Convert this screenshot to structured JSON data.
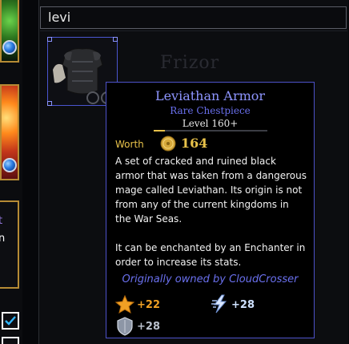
{
  "search": {
    "query": "levi"
  },
  "background": {
    "faded_label": "Frizor"
  },
  "left_panel": {
    "purple_char": "t",
    "white_char": "n"
  },
  "tooltip": {
    "name": "Leviathan Armor",
    "type": "Rare Chestpiece",
    "level": "Level 160+",
    "level_progress": 0.1,
    "worth_label": "Worth",
    "worth_value": "164",
    "description_1": "A set of cracked and ruined black armor that was taken from a dangerous mage called Leviathan. Its origin is not from any of the current kingdoms in the War Seas.",
    "description_2": "It can be enchanted by an Enchanter in order to increase its stats.",
    "owner": "Originally owned by CloudCrosser",
    "stats": {
      "power": "+22",
      "agility": "+28",
      "defense": "+28"
    }
  },
  "colors": {
    "rare_name": "#8e95ff",
    "gold": "#e8c24a",
    "stat_orange": "#f0a024",
    "stat_blue": "#cfe2ff",
    "stat_silver": "#b9c0cc"
  },
  "icons": {
    "coin": "gold-coin-icon",
    "power": "star-burst-icon",
    "agility": "lightning-icon",
    "defense": "shield-icon",
    "check": "checkmark-icon"
  }
}
